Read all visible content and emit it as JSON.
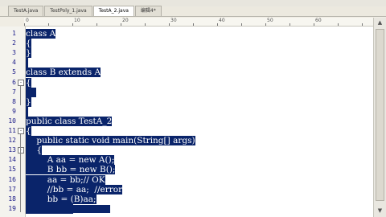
{
  "tabs": [
    {
      "label": "TestA.java",
      "active": false
    },
    {
      "label": "TestPoly_1.java",
      "active": false
    },
    {
      "label": "TestA_2.java",
      "active": true
    },
    {
      "label": "编辑4*",
      "active": false
    }
  ],
  "ruler": {
    "labels": [
      "0",
      "10",
      "20",
      "30",
      "40",
      "50",
      "60"
    ]
  },
  "lines": [
    {
      "num": "1",
      "text": "class A",
      "fold": ""
    },
    {
      "num": "2",
      "text": "{",
      "fold": ""
    },
    {
      "num": "3",
      "text": "}",
      "fold": ""
    },
    {
      "num": "4",
      "text": "",
      "fold": ""
    },
    {
      "num": "5",
      "text": "class B extends A",
      "fold": ""
    },
    {
      "num": "6",
      "text": "{",
      "fold": "-"
    },
    {
      "num": "7",
      "text": "    ",
      "fold": ""
    },
    {
      "num": "8",
      "text": "}",
      "fold": ""
    },
    {
      "num": "9",
      "text": "",
      "fold": ""
    },
    {
      "num": "10",
      "text": "public class TestA_2",
      "fold": ""
    },
    {
      "num": "11",
      "text": "{",
      "fold": "-"
    },
    {
      "num": "12",
      "text": "    public static void main(String[] args)",
      "fold": ""
    },
    {
      "num": "13",
      "text": "    {",
      "fold": "-"
    },
    {
      "num": "14",
      "text": "        A aa = new A();",
      "fold": ""
    },
    {
      "num": "15",
      "text": "        B bb = new B();",
      "fold": ""
    },
    {
      "num": "16",
      "text": "        aa = bb;// OK",
      "fold": ""
    },
    {
      "num": "17",
      "text": "        //bb = aa;  //error",
      "fold": ""
    },
    {
      "num": "18",
      "text": "        bb = (B)aa;",
      "fold": ""
    },
    {
      "num": "19",
      "text": "        bb.f();",
      "fold": ""
    }
  ],
  "colors": {
    "selection": "#0a246a",
    "selection_text": "#ffffff",
    "line_number": "#1a1a88"
  }
}
